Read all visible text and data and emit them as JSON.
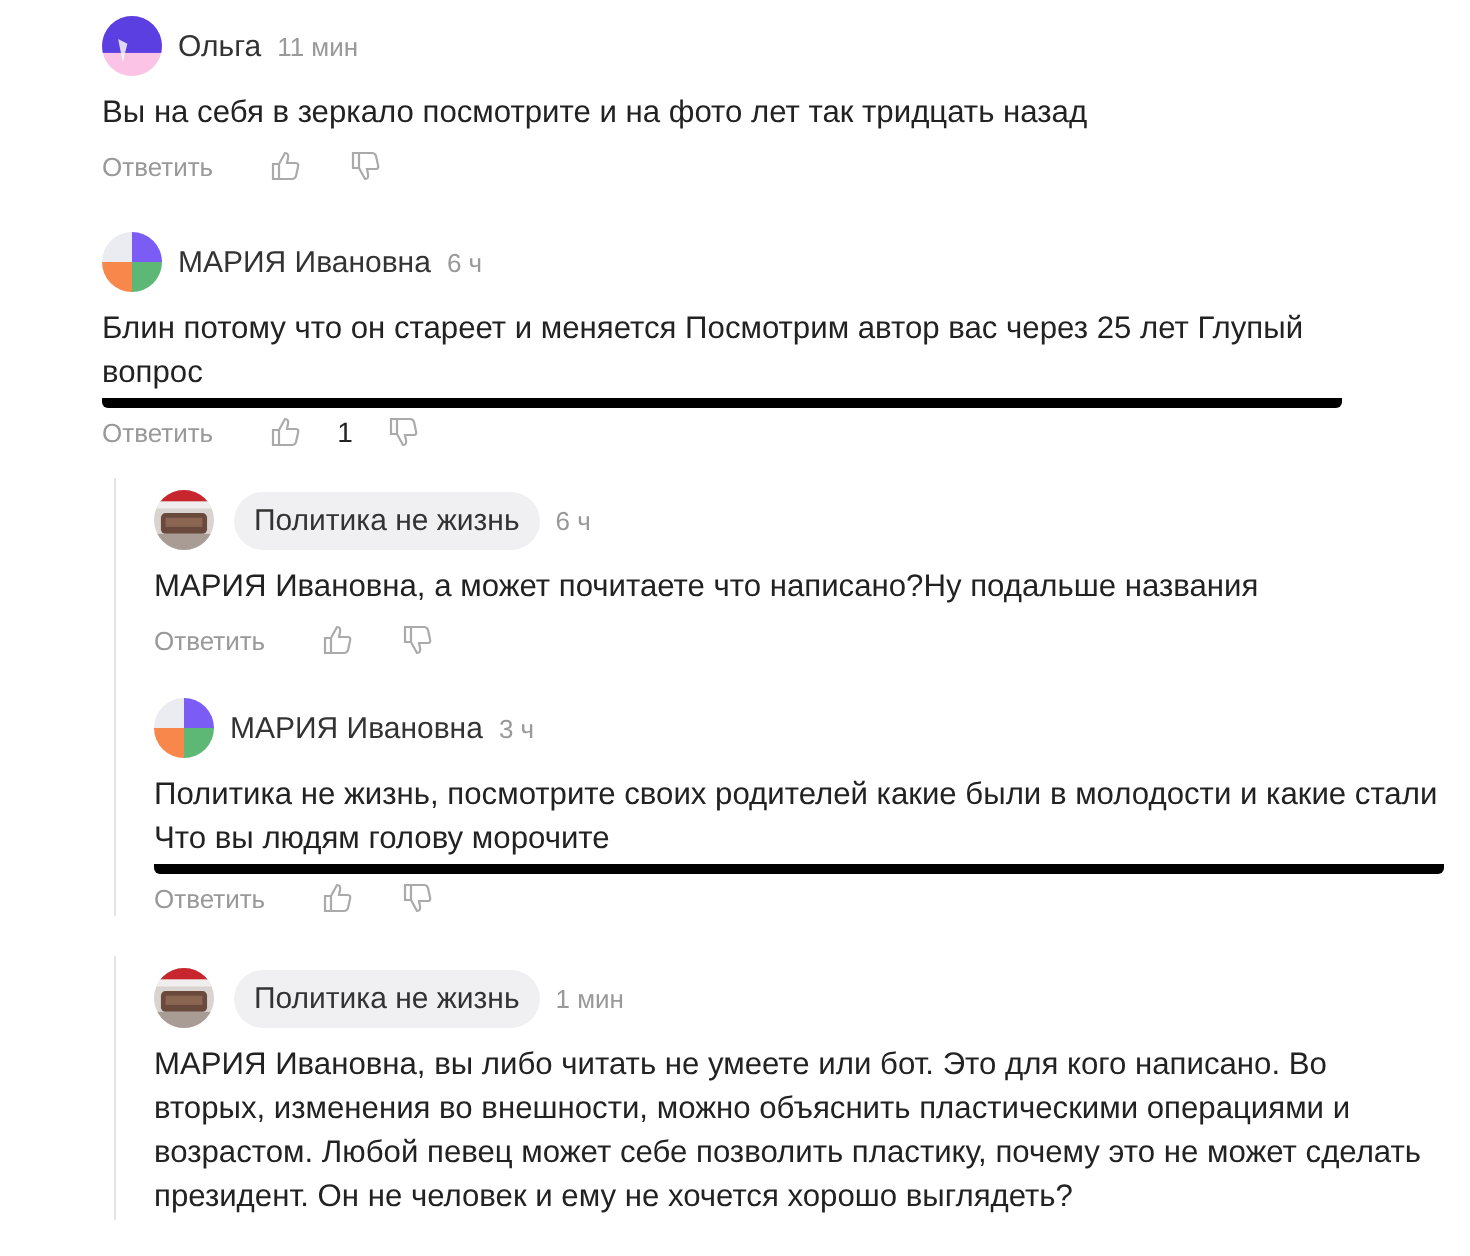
{
  "comments": [
    {
      "author": "Ольга",
      "time": "11 мин",
      "avatar": {
        "kind": "violet"
      },
      "text": "Вы на себя в зеркало посмотрите и на фото лет так тридцать назад",
      "reply": "Ответить",
      "scribble": false,
      "name_chip": false
    },
    {
      "author": "МАРИЯ Ивановна",
      "time": "6 ч",
      "avatar": {
        "kind": "quad"
      },
      "text": "Блин потому что он стареет и меняется Посмотрим автор вас через 25 лет Глупый вопрос",
      "reply": "Ответить",
      "likes": "1",
      "scribble": true,
      "name_chip": false,
      "reply_groups": [
        {
          "replies": [
            {
              "author": "Политика не жизнь",
              "time": "6 ч",
              "text": "МАРИЯ Ивановна, а может почитаете что написано?Ну подальше названия",
              "reply": "Ответить",
              "scribble": false,
              "name_chip": true
            },
            {
              "author": "МАРИЯ Ивановна",
              "time": "3 ч",
              "avatar": {
                "kind": "quad"
              },
              "text": "Политика не жизнь, посмотрите своих родителей какие были в молодости и какие стали Что вы людям голову морочите",
              "reply": "Ответить",
              "scribble": true,
              "name_chip": false
            }
          ]
        },
        {
          "replies": [
            {
              "author": "Политика не жизнь",
              "time": "1 мин",
              "text": "МАРИЯ Ивановна, вы либо читать не умеете или бот. Это для кого написано. Во вторых, изменения во внешности, можно объяснить пластическими операциями и возрастом. Любой певец может себе позволить пластику, почему это не может сделать президент. Он не человек и ему не хочется хорошо выглядеть?",
              "scribble": false,
              "name_chip": true
            }
          ]
        }
      ]
    }
  ]
}
